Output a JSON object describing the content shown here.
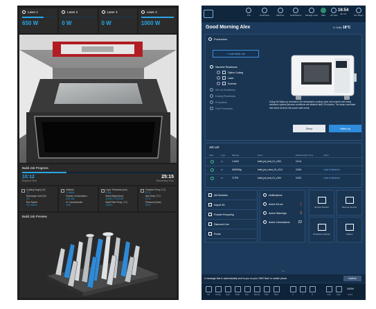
{
  "lasers": [
    {
      "label": "Laser 1",
      "value": "650 W",
      "level": 0.65
    },
    {
      "label": "Laser 2",
      "value": "0 W",
      "level": 0
    },
    {
      "label": "Laser 3",
      "value": "0 W",
      "level": 0
    },
    {
      "label": "Laser 4",
      "value": "1000 W",
      "level": 1.0
    }
  ],
  "progress": {
    "title": "Build Job Progress",
    "elapsed": "10:12",
    "remaining": "25:15",
    "elapsed_label": "Elapsed Time",
    "remaining_label": "Remaining Time",
    "fraction": 0.29
  },
  "stats": [
    {
      "lines": [
        "Coating Supply (%)",
        "77",
        "Discharge Level (%)",
        "23",
        "Run Speed",
        "19 mm/s"
      ]
    },
    {
      "lines": [
        "Material",
        "1.4404",
        "Powder Consumption",
        "237.83",
        "N. Contaminants",
        "142"
      ]
    },
    {
      "lines": [
        "Layer Thickness (mm)",
        "0.06",
        "Build Height (mm)",
        "24.00 / 176.00",
        "Build Plate Temp. (°C)",
        "200.0"
      ]
    },
    {
      "lines": [
        "Chamber Temp. (°C)",
        "27.3",
        "Gas Temp. (°C)",
        "27.4",
        "Pressure (mbar)",
        "20.0"
      ]
    }
  ],
  "preview": {
    "title": "Build Job Preview"
  },
  "topbar": {
    "nav": [
      {
        "label": "Job",
        "active": false
      },
      {
        "label": "Production",
        "active": false
      },
      {
        "label": "Machine",
        "active": false
      },
      {
        "label": "Notifications",
        "active": false
      },
      {
        "label": "Manage Jobs",
        "active": false
      },
      {
        "label": "Start",
        "active": true
      },
      {
        "label": "All Jobs",
        "active": false
      }
    ],
    "time": "16:54",
    "date": "Jan 12",
    "user": "Kim Bayer"
  },
  "greeting": "Good Morning Alex",
  "weather": {
    "city": "N. Baltic",
    "temp": "18°C"
  },
  "production": {
    "title": "Production",
    "load_button": "+ Load Build Job",
    "readiness_title": "Machine Readiness",
    "readiness_items": [
      "Optics Cooling",
      "Laser",
      "Scanner"
    ],
    "steps": [
      "Set Up Readiness",
      "Dosing Readiness",
      "Production",
      "Post Production"
    ],
    "wakeup_text": "Using the Wake-up command, the subsystems cooling, laser and scanner are being activated; optimal process conditions are attained after 30 minutes. The sleep command sets these devices into power safe mode.",
    "sleep_label": "Sleep",
    "wake_label": "Wake-up"
  },
  "job_list": {
    "title": "Job List",
    "columns": [
      "State",
      "Type",
      "Material",
      "Name",
      "Estimated Run Time",
      "Action"
    ],
    "rows": [
      {
        "material": "1.4404",
        "name": "build_job_test_01_v100",
        "time": "10:14",
        "action": ""
      },
      {
        "material": "AlSi10Mg",
        "name": "build_job_robot_02_v214",
        "time": "10:56",
        "action": "Load to Machine"
      },
      {
        "material": "Ti-TF6",
        "name": "build_job_test_01_v100",
        "time": "10:20",
        "action": "Load to Machine"
      }
    ]
  },
  "modules": {
    "title": "AM Modules",
    "items": [
      "Import 3D",
      "Powder Recycling",
      "Diamond Line",
      "Portal"
    ]
  },
  "notifications": {
    "title": "Notifications",
    "items": [
      {
        "label": "Active Errors",
        "count": "1",
        "color": "#e0504a"
      },
      {
        "label": "Active Warnings",
        "count": "3",
        "color": "#f2a21f"
      },
      {
        "label": "Active Informations",
        "count": "22",
        "color": "#ffffff"
      }
    ]
  },
  "tiles": [
    "Service Monitor",
    "Remote Service",
    "Production Monitor",
    "Utilities"
  ],
  "toast": {
    "text": "A message that is automatically sent to you on your HMI Panel or mobile phone",
    "action": "Archive"
  },
  "bottombar": [
    "Cal",
    "M.Rdy",
    "Light",
    "Build",
    "Exp.",
    "Recoat",
    "Filter",
    "Pano",
    "X",
    "Y",
    "Z",
    "Lock",
    "Help",
    "100%",
    "Zoom"
  ]
}
